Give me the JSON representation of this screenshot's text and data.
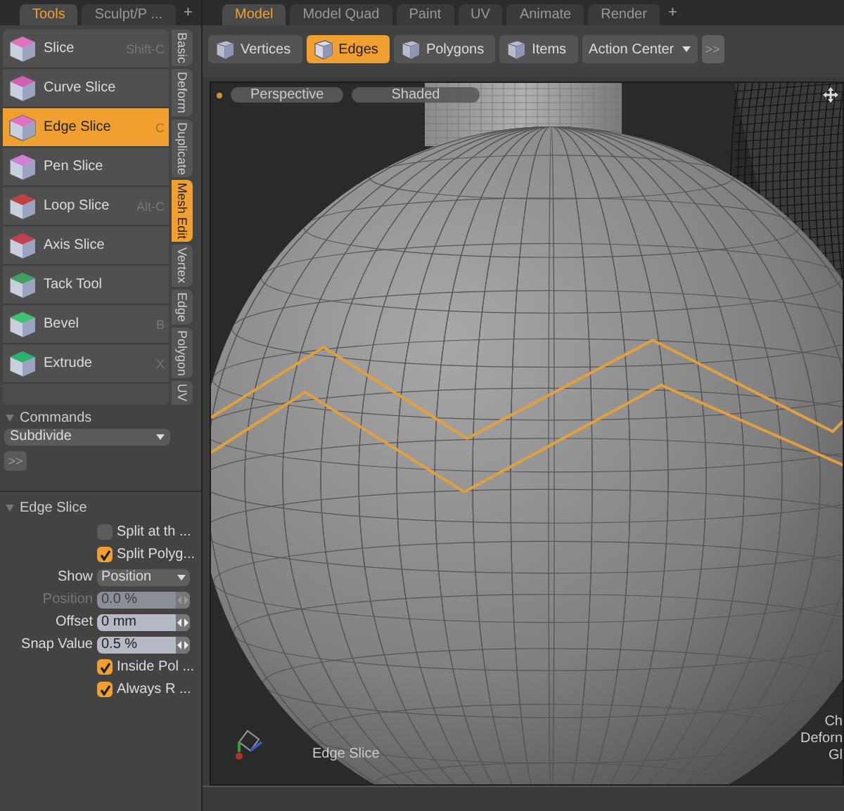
{
  "left_tabs": [
    {
      "label": "Tools",
      "selected": true
    },
    {
      "label": "Sculpt/P ...",
      "selected": false
    }
  ],
  "left_add": "+",
  "tools": [
    {
      "label": "Slice",
      "shortcut": "Shift-C",
      "selected": false
    },
    {
      "label": "Curve Slice",
      "selected": false
    },
    {
      "label": "Edge Slice",
      "shortcut": "C",
      "selected": true
    },
    {
      "label": "Pen Slice",
      "selected": false
    },
    {
      "label": "Loop Slice",
      "shortcut": "Alt-C",
      "selected": false
    },
    {
      "label": "Axis Slice",
      "selected": false
    },
    {
      "label": "Tack Tool",
      "selected": false
    },
    {
      "label": "Bevel",
      "shortcut": "B",
      "selected": false
    },
    {
      "label": "Extrude",
      "shortcut": "X",
      "selected": false
    }
  ],
  "side_tabs": [
    {
      "label": "Basic",
      "selected": false
    },
    {
      "label": "Deform",
      "selected": false
    },
    {
      "label": "Duplicate",
      "selected": false
    },
    {
      "label": "Mesh Edit",
      "selected": true
    },
    {
      "label": "Vertex",
      "selected": false
    },
    {
      "label": "Edge",
      "selected": false
    },
    {
      "label": "Polygon",
      "selected": false
    },
    {
      "label": "UV",
      "selected": false
    }
  ],
  "commands": {
    "title": "Commands",
    "dropdown": "Subdivide",
    "more": ">>"
  },
  "edge_slice": {
    "title": "Edge Slice",
    "rows": [
      {
        "kind": "checkbox",
        "label": "Split at th ...",
        "checked": false
      },
      {
        "kind": "checkbox",
        "label": "Split Polyg...",
        "checked": true
      },
      {
        "kind": "dropdown",
        "label": "Show",
        "value": "Position"
      },
      {
        "kind": "number",
        "label": "Position",
        "value": "0.0 %",
        "disabled": true
      },
      {
        "kind": "number",
        "label": "Offset",
        "value": "0 mm",
        "disabled": false
      },
      {
        "kind": "number",
        "label": "Snap Value",
        "value": "0.5 %",
        "disabled": false
      },
      {
        "kind": "checkbox",
        "label": "Inside Pol ...",
        "checked": true
      },
      {
        "kind": "checkbox",
        "label": "Always R ...",
        "checked": true
      }
    ]
  },
  "main_tabs": [
    {
      "label": "Model",
      "selected": true
    },
    {
      "label": "Model Quad",
      "selected": false
    },
    {
      "label": "Paint",
      "selected": false
    },
    {
      "label": "UV",
      "selected": false
    },
    {
      "label": "Animate",
      "selected": false
    },
    {
      "label": "Render",
      "selected": false
    }
  ],
  "main_add": "+",
  "toolbar": {
    "modes": [
      {
        "label": "Vertices",
        "selected": false
      },
      {
        "label": "Edges",
        "selected": true
      },
      {
        "label": "Polygons",
        "selected": false
      },
      {
        "label": "Items",
        "selected": false
      }
    ],
    "action_center": "Action Center",
    "more": ">>"
  },
  "viewport": {
    "view": "Perspective",
    "shading": "Shaded",
    "tool_label": "Edge Slice",
    "info_lines": [
      "Ch",
      "Deforn",
      "Gl"
    ]
  }
}
